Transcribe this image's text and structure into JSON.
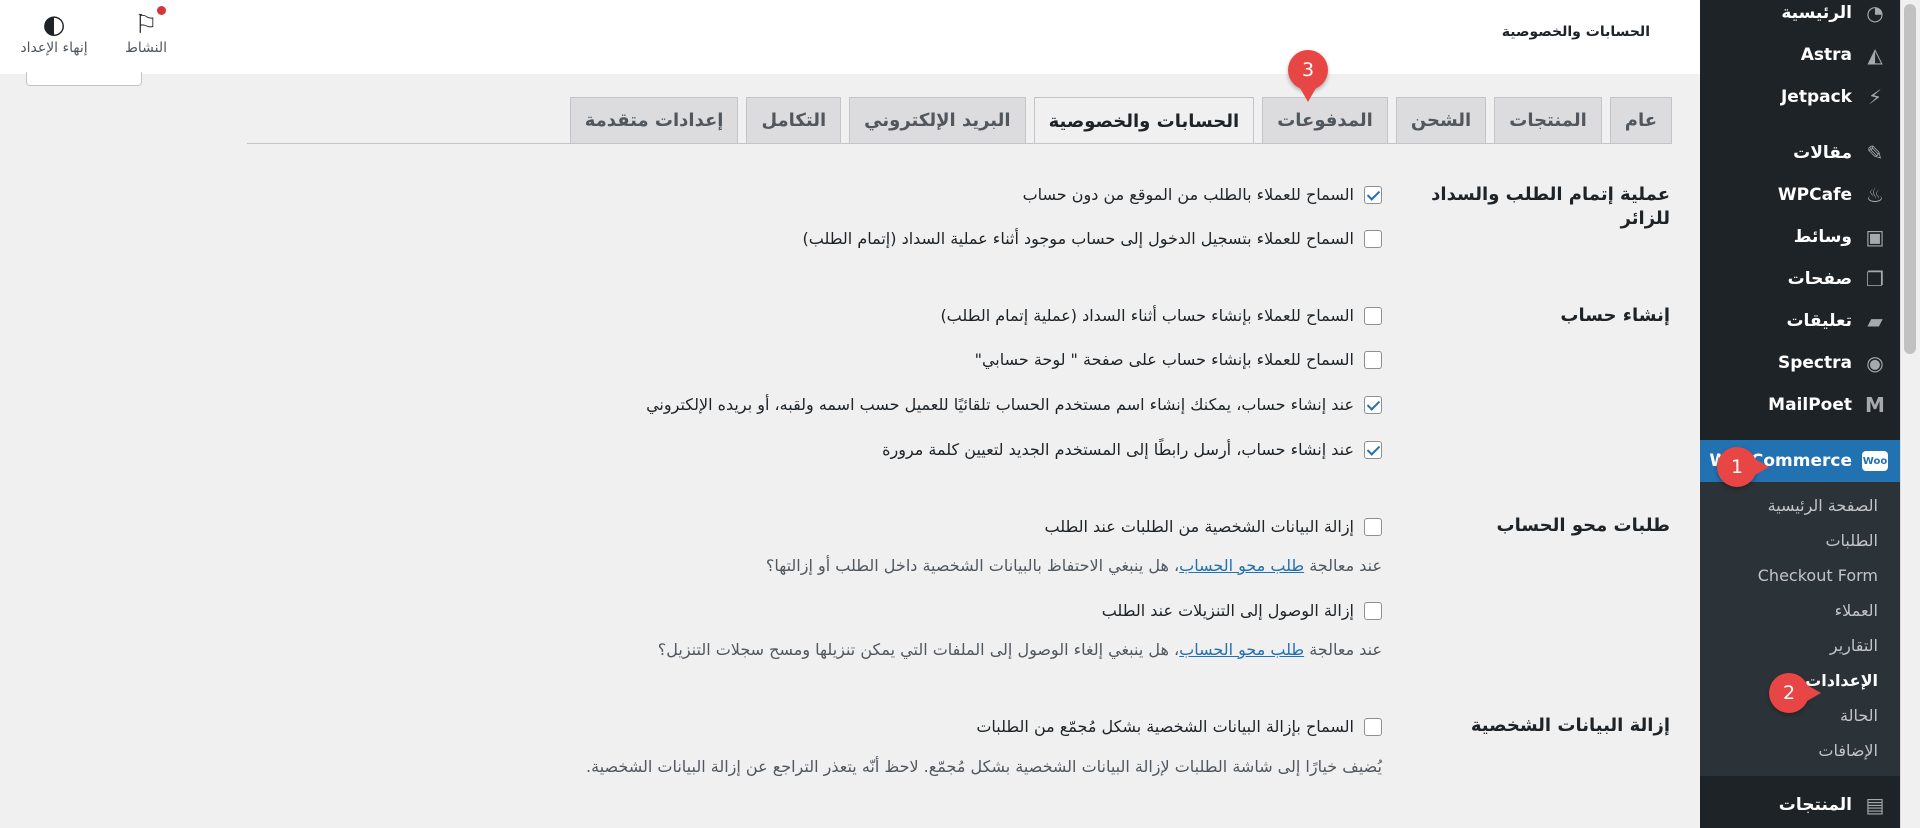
{
  "topbar": {
    "title": "الحسابات والخصوصية",
    "activity_label": "النشاط",
    "finish_setup_label": "إنهاء الإعداد"
  },
  "sidebar": {
    "items_top": [
      {
        "label": "الرئيسية",
        "icon": "dashboard-icon"
      },
      {
        "label": "Astra",
        "icon": "astra-icon"
      },
      {
        "label": "Jetpack",
        "icon": "jetpack-icon"
      },
      {
        "label": "مقالات",
        "icon": "pin-icon"
      },
      {
        "label": "WPCafe",
        "icon": "wpcafe-icon"
      },
      {
        "label": "وسائط",
        "icon": "media-icon"
      },
      {
        "label": "صفحات",
        "icon": "pages-icon"
      },
      {
        "label": "تعليقات",
        "icon": "comments-icon"
      },
      {
        "label": "Spectra",
        "icon": "spectra-icon"
      },
      {
        "label": "MailPoet",
        "icon": "mailpoet-icon"
      }
    ],
    "woocommerce": {
      "label": "WooCommerce",
      "badge": "Woo"
    },
    "submenu": [
      {
        "label": "الصفحة الرئيسية"
      },
      {
        "label": "الطلبات"
      },
      {
        "label": "Checkout Form"
      },
      {
        "label": "العملاء"
      },
      {
        "label": "التقارير"
      },
      {
        "label": "الإعدادات"
      },
      {
        "label": "الحالة"
      },
      {
        "label": "الإضافات"
      }
    ],
    "bottom_item": {
      "label": "المنتجات",
      "icon": "products-icon"
    }
  },
  "tabs": [
    {
      "label": "عام"
    },
    {
      "label": "المنتجات"
    },
    {
      "label": "الشحن"
    },
    {
      "label": "المدفوعات"
    },
    {
      "label": "الحسابات والخصوصية"
    },
    {
      "label": "البريد الإلكتروني"
    },
    {
      "label": "التكامل"
    },
    {
      "label": "إعدادات متقدمة"
    }
  ],
  "markers": {
    "one": "1",
    "two": "2",
    "three": "3"
  },
  "sections": {
    "guest_checkout": {
      "label": "عملية إتمام الطلب والسداد للزائر",
      "opt1": "السماح للعملاء بالطلب من الموقع من دون حساب",
      "opt2": "السماح للعملاء بتسجيل الدخول إلى حساب موجود أثناء عملية السداد (إتمام الطلب)"
    },
    "account_creation": {
      "label": "إنشاء حساب",
      "opt1": "السماح للعملاء بإنشاء حساب أثناء السداد (عملية إتمام الطلب)",
      "opt2": "السماح للعملاء بإنشاء حساب على صفحة \" لوحة حسابي\"",
      "opt3": "عند إنشاء حساب، يمكنك إنشاء اسم مستخدم الحساب تلقائيًا للعميل حسب اسمه ولقبه، أو بريده الإلكتروني",
      "opt4": "عند إنشاء حساب، أرسل رابطًا إلى المستخدم الجديد لتعيين كلمة مرورة"
    },
    "erasure": {
      "label": "طلبات محو الحساب",
      "opt1": "إزالة البيانات الشخصية من الطلبات عند الطلب",
      "desc1_pre": "عند معالجة ",
      "desc1_link": "طلب محو الحساب",
      "desc1_post": "، هل ينبغي الاحتفاظ بالبيانات الشخصية داخل الطلب أو إزالتها؟",
      "opt2": "إزالة الوصول إلى التنزيلات عند الطلب",
      "desc2_pre": "عند معالجة ",
      "desc2_link": "طلب محو الحساب",
      "desc2_post": "، هل ينبغي إلغاء الوصول إلى الملفات التي يمكن تنزيلها ومسح سجلات التنزيل؟"
    },
    "personal_data": {
      "label": "إزالة البيانات الشخصية",
      "opt1": "السماح بإزالة البيانات الشخصية بشكل مُجمّع من الطلبات",
      "desc1": "يُضيف خيارًا إلى شاشة الطلبات لإزالة البيانات الشخصية بشكل مُجمّع. لاحظ أنّه يتعذر التراجع عن إزالة البيانات الشخصية."
    }
  },
  "colors": {
    "accent": "#2271b1",
    "sidebar_bg": "#1d2327",
    "marker": "#e84545"
  }
}
